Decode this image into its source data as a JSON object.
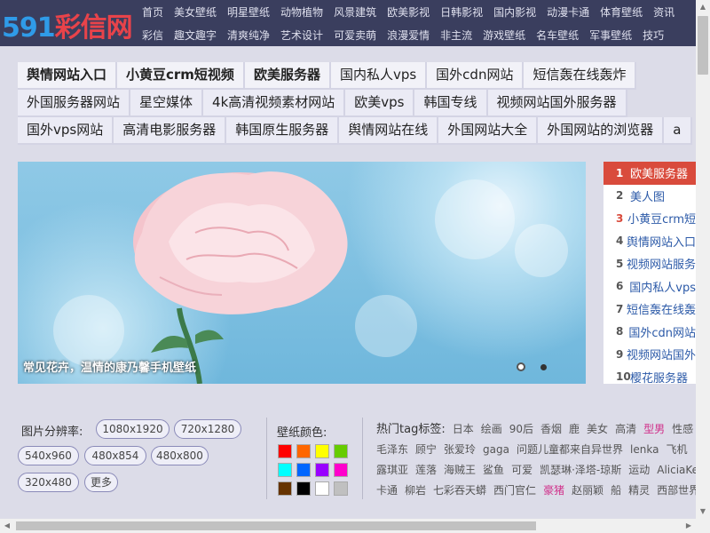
{
  "logo": {
    "number": "591",
    "name": "彩信网"
  },
  "nav": {
    "row1": [
      "首页",
      "美女壁纸",
      "明星壁纸",
      "动物植物",
      "风景建筑",
      "欧美影视",
      "日韩影视",
      "国内影视",
      "动漫卡通",
      "体育壁纸",
      "资讯"
    ],
    "row2": [
      "彩信",
      "趣文趣字",
      "清爽纯净",
      "艺术设计",
      "可爱卖萌",
      "浪漫爱情",
      "非主流",
      "游戏壁纸",
      "名车壁纸",
      "军事壁纸",
      "技巧"
    ]
  },
  "tags": {
    "row1": [
      {
        "label": "舆情网站入口",
        "bold": true
      },
      {
        "label": "小黄豆crm短视频",
        "bold": true
      },
      {
        "label": "欧美服务器",
        "bold": true
      },
      {
        "label": "国内私人vps",
        "bold": false
      },
      {
        "label": "国外cdn网站",
        "bold": false
      },
      {
        "label": "短信轰在线轰炸",
        "bold": false
      }
    ],
    "row2": [
      "外国服务器网站",
      "星空媒体",
      "4k高清视频素材网站",
      "欧美vps",
      "韩国专线",
      "视频网站国外服务器"
    ],
    "row3": [
      "国外vps网站",
      "高清电影服务器",
      "韩国原生服务器",
      "舆情网站在线",
      "外国网站大全",
      "外国网站的浏览器",
      "a"
    ]
  },
  "slider": {
    "caption": "常见花卉，温情的康乃馨手机壁纸"
  },
  "ranking": [
    {
      "idx": "1",
      "label": "欧美服务器"
    },
    {
      "idx": "2",
      "label": "美人图"
    },
    {
      "idx": "3",
      "label": "小黄豆crm短"
    },
    {
      "idx": "4",
      "label": "舆情网站入口"
    },
    {
      "idx": "5",
      "label": "视频网站服务"
    },
    {
      "idx": "6",
      "label": "国内私人vps"
    },
    {
      "idx": "7",
      "label": "短信轰在线轰"
    },
    {
      "idx": "8",
      "label": "国外cdn网站"
    },
    {
      "idx": "9",
      "label": "视频网站国外"
    },
    {
      "idx": "10",
      "label": "樱花服务器"
    }
  ],
  "resolution": {
    "label": "图片分辨率:",
    "options": [
      "1080x1920",
      "720x1280",
      "540x960",
      "480x854",
      "480x800",
      "320x480",
      "更多"
    ]
  },
  "colors": {
    "label": "壁纸颜色:",
    "swatches": [
      "#ff0000",
      "#ff6600",
      "#ffff00",
      "#66cc00",
      "#00ffff",
      "#0066ff",
      "#9900ff",
      "#ff00cc",
      "#663300",
      "#000000",
      "#ffffff",
      "#c0c0c0"
    ]
  },
  "hot_tags": {
    "label": "热门tag标签:",
    "row1": [
      "日本",
      "绘画",
      "90后",
      "香烟",
      "鹿",
      "美女",
      "高清",
      "型男",
      "性感"
    ],
    "row2": [
      "毛泽东",
      "顾宁",
      "张爱玲",
      "gaga",
      "问题儿童都来自异世界",
      "lenka",
      "飞机"
    ],
    "row3": [
      "露琪亚",
      "莲落",
      "海贼王",
      "鲨鱼",
      "可爱",
      "凯瑟琳·泽塔-琼斯",
      "运动",
      "AliciaKe"
    ],
    "row4": [
      "卡通",
      "柳岩",
      "七彩吞天蟒",
      "西门官仁",
      "豪猪",
      "赵丽颖",
      "船",
      "精灵",
      "西部世界"
    ],
    "pink": [
      "型男",
      "豪猪"
    ]
  }
}
